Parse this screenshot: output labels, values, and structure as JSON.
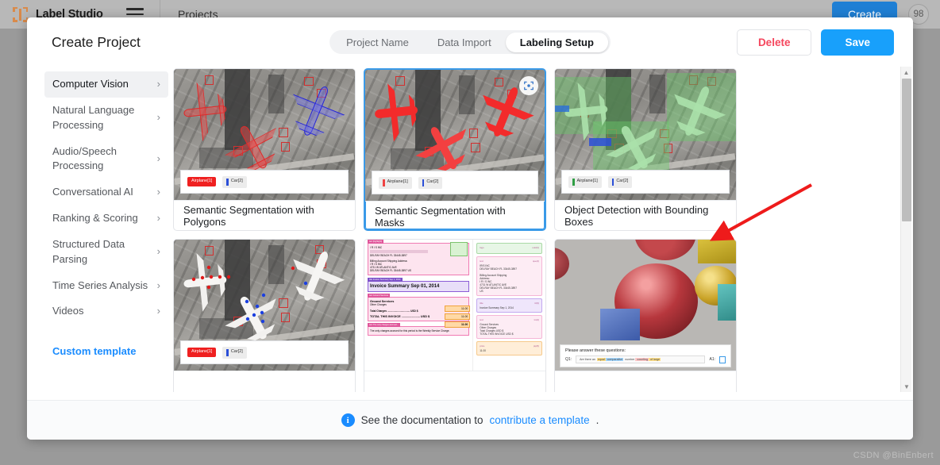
{
  "topbar": {
    "brand": "Label Studio",
    "menu_icon": "hamburger-icon",
    "breadcrumb": "Projects",
    "create_label": "Create",
    "badge_count": "98"
  },
  "modal": {
    "title": "Create Project",
    "tabs": [
      {
        "label": "Project Name",
        "active": false
      },
      {
        "label": "Data Import",
        "active": false
      },
      {
        "label": "Labeling Setup",
        "active": true
      }
    ],
    "delete_label": "Delete",
    "save_label": "Save"
  },
  "sidebar": {
    "items": [
      {
        "label": "Computer Vision",
        "active": true
      },
      {
        "label": "Natural Language Processing",
        "active": false
      },
      {
        "label": "Audio/Speech Processing",
        "active": false
      },
      {
        "label": "Conversational AI",
        "active": false
      },
      {
        "label": "Ranking & Scoring",
        "active": false
      },
      {
        "label": "Structured Data Parsing",
        "active": false
      },
      {
        "label": "Time Series Analysis",
        "active": false
      },
      {
        "label": "Videos",
        "active": false
      }
    ],
    "chevron": "›",
    "custom_template": "Custom template"
  },
  "templates": [
    {
      "title": "Semantic Segmentation with Polygons",
      "selected": false,
      "labels": [
        {
          "text": "Airplane",
          "shortcut": "[1]",
          "style": "filled",
          "color": "#ef2020"
        },
        {
          "text": "Car",
          "shortcut": "[2]",
          "style": "outline",
          "color": "#2b4fd8"
        }
      ]
    },
    {
      "title": "Semantic Segmentation with Masks",
      "selected": true,
      "labels": [
        {
          "text": "Airplane",
          "shortcut": "[1]",
          "style": "outline",
          "color": "#ef4444"
        },
        {
          "text": "Car",
          "shortcut": "[2]",
          "style": "outline",
          "color": "#2b4fd8"
        }
      ]
    },
    {
      "title": "Object Detection with Bounding Boxes",
      "selected": false,
      "labels": [
        {
          "text": "Airplane",
          "shortcut": "[1]",
          "style": "outline",
          "color": "#2f9e44"
        },
        {
          "text": "Car",
          "shortcut": "[2]",
          "style": "outline",
          "color": "#2b4fd8"
        }
      ]
    },
    {
      "title": "",
      "selected": false,
      "labels": [
        {
          "text": "Airplane",
          "shortcut": "[1]",
          "style": "filled",
          "color": "#ef2020"
        },
        {
          "text": "Car",
          "shortcut": "[2]",
          "style": "outline",
          "color": "#2b4fd8"
        }
      ]
    },
    {
      "title": "",
      "selected": false,
      "labels": []
    },
    {
      "title": "",
      "selected": false,
      "labels": []
    }
  ],
  "invoice_preview": {
    "header_tag": "text  [highlight]",
    "company": "IRIS INC",
    "addr1": "I R I S INC",
    "addr2": "DELRAY BEACH FL 33445-3897",
    "billing_label": "Billing Account Shipping Address:",
    "billing1": "I R I S INC",
    "billing2": "4731 W ATLANTIC AVE",
    "billing3": "DELRAY BEACH FL  33445-3897 US",
    "title_tag": "title  Invoice Summary Sep 1, 2014",
    "invoice_title": "Invoice Summary Sep 01, 2014",
    "sect_tag": "text  Ground Services",
    "ground": "Ground Services",
    "other": "Other Charges",
    "total_charges": "Total Charges ................................ USD $",
    "total_invoice": "TOTAL THIS INVOICE ...................... USD $",
    "amounts": [
      "11.00",
      "11.00",
      "11.00"
    ],
    "note_tag": "text  The only charges accrued...",
    "note": "The only charges accrued for this period is the Weekly Service Charge.",
    "right_panel": [
      {
        "tag": "logo",
        "code": "uuid(1)",
        "body": ""
      },
      {
        "tag": "text",
        "code": "que(2)",
        "body": "IRIS INC\nDELRAY BEACH FL 33445-3897\n\nBilling Account Shipping\nAddress:\nI R I S INC\n4731 W ATLANTIC AVE\nDELRAY BEACH FL 33445-3897\nUS"
      },
      {
        "tag": "title",
        "code": "ttl(3)",
        "body": "Invoice Summary Sep 1, 2014"
      },
      {
        "tag": "text",
        "code": "txt(4)",
        "body": "Ground Services\nOther Charges\nTotal Charges USD $\nTOTAL THIS INVOICE USD $"
      },
      {
        "tag": "price",
        "code": "pip(5)",
        "body": "11.00"
      }
    ]
  },
  "vqa_preview": {
    "prompt": "Please answer these questions:",
    "q_label": "Q1:",
    "question_parts": [
      {
        "text": "Are there an ",
        "hl": ""
      },
      {
        "text": "equal",
        "hl": "#ffe08a"
      },
      {
        "text": " comparative",
        "hl": "#a5d8ff"
      },
      {
        "text": " number",
        "hl": ""
      },
      {
        "text": " counting",
        "hl": "#ffc9c9"
      },
      {
        "text": " of large",
        "hl": "#ffe08a"
      }
    ],
    "a_label": "A1:",
    "a_value": ""
  },
  "scrollbar": {
    "up_arrow": "▲",
    "down_arrow": "▼"
  },
  "footer": {
    "info_icon": "info-icon",
    "text_before": "See the documentation to ",
    "link": "contribute a template",
    "text_after": "."
  },
  "annotation": {
    "arrow_color": "#ee1b1b"
  },
  "watermark": "CSDN @BinEnbert"
}
